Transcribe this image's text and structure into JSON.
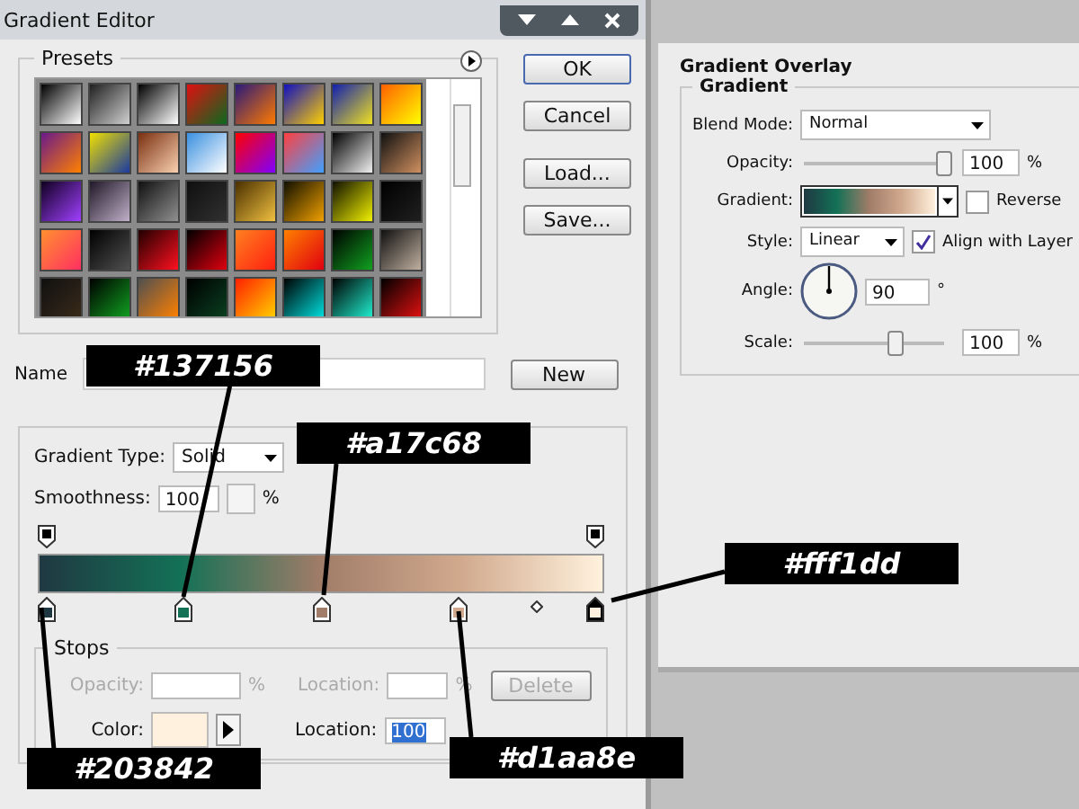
{
  "window": {
    "title": "Gradient Editor"
  },
  "presets": {
    "label": "Presets"
  },
  "buttons": [
    "OK",
    "Cancel",
    "Load...",
    "Save..."
  ],
  "name_label": "Name",
  "new_button": "New",
  "gradient_type": {
    "label": "Gradient Type:",
    "value": "Solid"
  },
  "smoothness": {
    "label": "Smoothness:",
    "value": "100",
    "unit": "%"
  },
  "color_stops": [
    {
      "color": "#203842",
      "selected": false
    },
    {
      "color": "#137156",
      "selected": false
    },
    {
      "color": "#a17c68",
      "selected": false
    },
    {
      "color": "#d1aa8e",
      "selected": false
    },
    {
      "color": "#fff1dd",
      "selected": true
    }
  ],
  "stops": {
    "label": "Stops",
    "opacity_row": {
      "label": "Opacity:",
      "unit": "%",
      "location_label": "Location:",
      "location_unit": "%",
      "button": "Delete",
      "disabled": true
    },
    "color_row": {
      "label": "Color:",
      "color": "#fff1dd",
      "location_label": "Location:",
      "location_value": "100"
    }
  },
  "callouts": [
    {
      "text": "#137156"
    },
    {
      "text": "#a17c68"
    },
    {
      "text": "#fff1dd"
    },
    {
      "text": "#203842"
    },
    {
      "text": "#d1aa8e"
    }
  ],
  "overlay": {
    "title": "Gradient Overlay",
    "group": "Gradient",
    "blend_mode": {
      "label": "Blend Mode:",
      "value": "Normal"
    },
    "opacity": {
      "label": "Opacity:",
      "level": 1,
      "value": "100",
      "unit": "%"
    },
    "gradient": {
      "label": "Gradient:"
    },
    "reverse": {
      "label": "Reverse",
      "checked": false
    },
    "style": {
      "label": "Style:",
      "value": "Linear"
    },
    "align": {
      "label": "Align with Layer",
      "checked": true
    },
    "angle": {
      "label": "Angle:",
      "value": "90",
      "unit": "°"
    },
    "scale": {
      "label": "Scale:",
      "level": 0.66,
      "value": "100",
      "unit": "%"
    }
  }
}
